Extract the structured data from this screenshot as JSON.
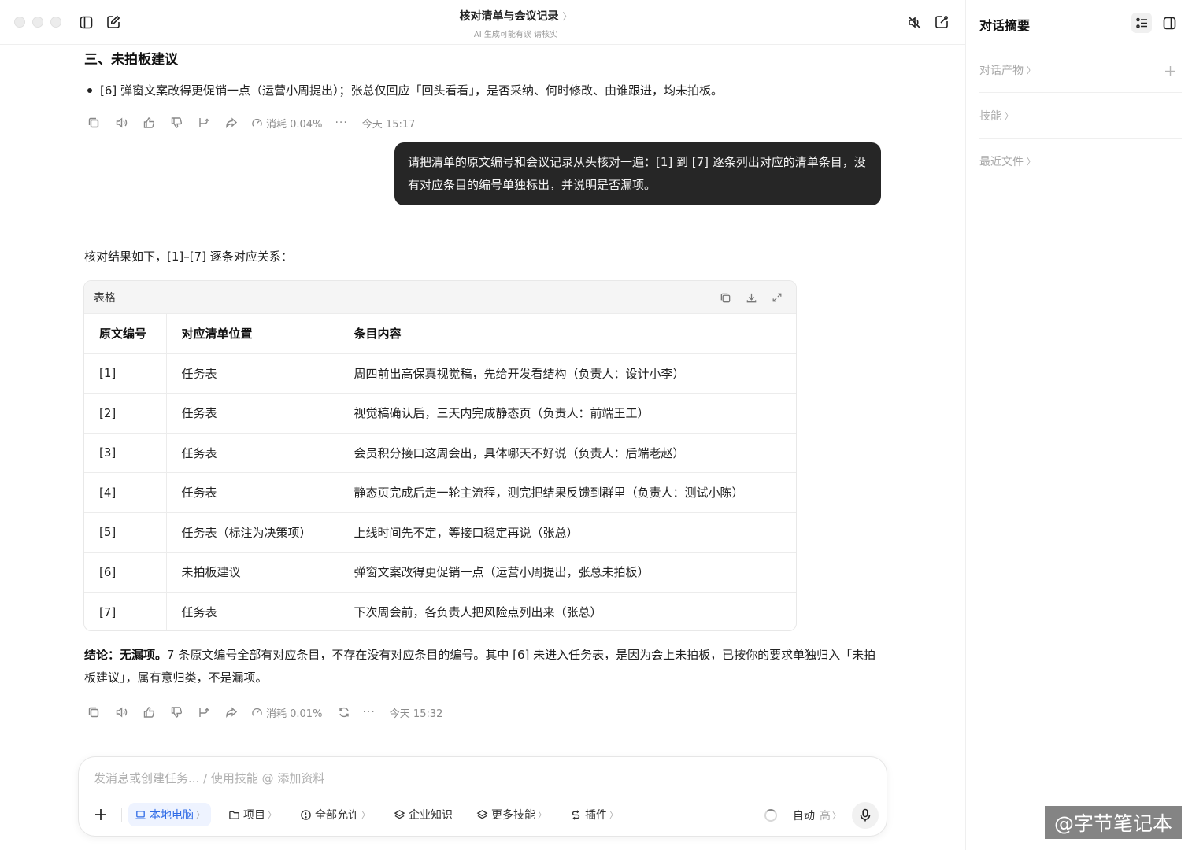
{
  "header": {
    "title": "核对清单与会议记录",
    "title_chevron": "〉",
    "subtitle": "AI 生成可能有误 请核实"
  },
  "section": {
    "heading": "三、未拍板建议",
    "bullet": "[6] 弹窗文案改得更促销一点（运营小周提出）；张总仅回应「回头看看」，是否采纳、何时修改、由谁跟进，均未拍板。"
  },
  "actions1": {
    "consume": "消耗 0.04%",
    "more": "···",
    "time": "今天 15:17"
  },
  "user_message": "请把清单的原文编号和会议记录从头核对一遍：[1] 到 [7] 逐条列出对应的清单条目，没有对应条目的编号单独标出，并说明是否漏项。",
  "reply": {
    "intro": "核对结果如下，[1]–[7] 逐条对应关系：",
    "table_label": "表格",
    "columns": [
      "原文编号",
      "对应清单位置",
      "条目内容"
    ],
    "rows": [
      [
        "[1]",
        "任务表",
        "周四前出高保真视觉稿，先给开发看结构（负责人：设计小李）"
      ],
      [
        "[2]",
        "任务表",
        "视觉稿确认后，三天内完成静态页（负责人：前端王工）"
      ],
      [
        "[3]",
        "任务表",
        "会员积分接口这周会出，具体哪天不好说（负责人：后端老赵）"
      ],
      [
        "[4]",
        "任务表",
        "静态页完成后走一轮主流程，测完把结果反馈到群里（负责人：测试小陈）"
      ],
      [
        "[5]",
        "任务表（标注为决策项）",
        "上线时间先不定，等接口稳定再说（张总）"
      ],
      [
        "[6]",
        "未拍板建议",
        "弹窗文案改得更促销一点（运营小周提出，张总未拍板）"
      ],
      [
        "[7]",
        "任务表",
        "下次周会前，各负责人把风险点列出来（张总）"
      ]
    ],
    "conclusion_bold": "结论：无漏项。",
    "conclusion_text": "7 条原文编号全部有对应条目，不存在没有对应条目的编号。其中 [6] 未进入任务表，是因为会上未拍板，已按你的要求单独归入「未拍板建议」，属有意归类，不是漏项。"
  },
  "actions2": {
    "consume": "消耗 0.01%",
    "more": "···",
    "time": "今天 15:32"
  },
  "composer": {
    "placeholder": "发消息或创建任务... / 使用技能 @ 添加资料",
    "local": "本地电脑",
    "project": "项目",
    "allow_all": "全部允许",
    "enterprise": "企业知识",
    "more_skills": "更多技能",
    "plugins": "插件",
    "auto": "自动",
    "level": "高",
    "chevron": "〉"
  },
  "sidebar": {
    "title": "对话摘要",
    "artifacts": "对话产物",
    "skills": "技能",
    "recent_files": "最近文件",
    "chevron": "〉"
  },
  "watermark": "@字节笔记本",
  "colors": {
    "accent": "#2f6be6",
    "bubble": "#262626",
    "muted": "#8a8a8a"
  }
}
